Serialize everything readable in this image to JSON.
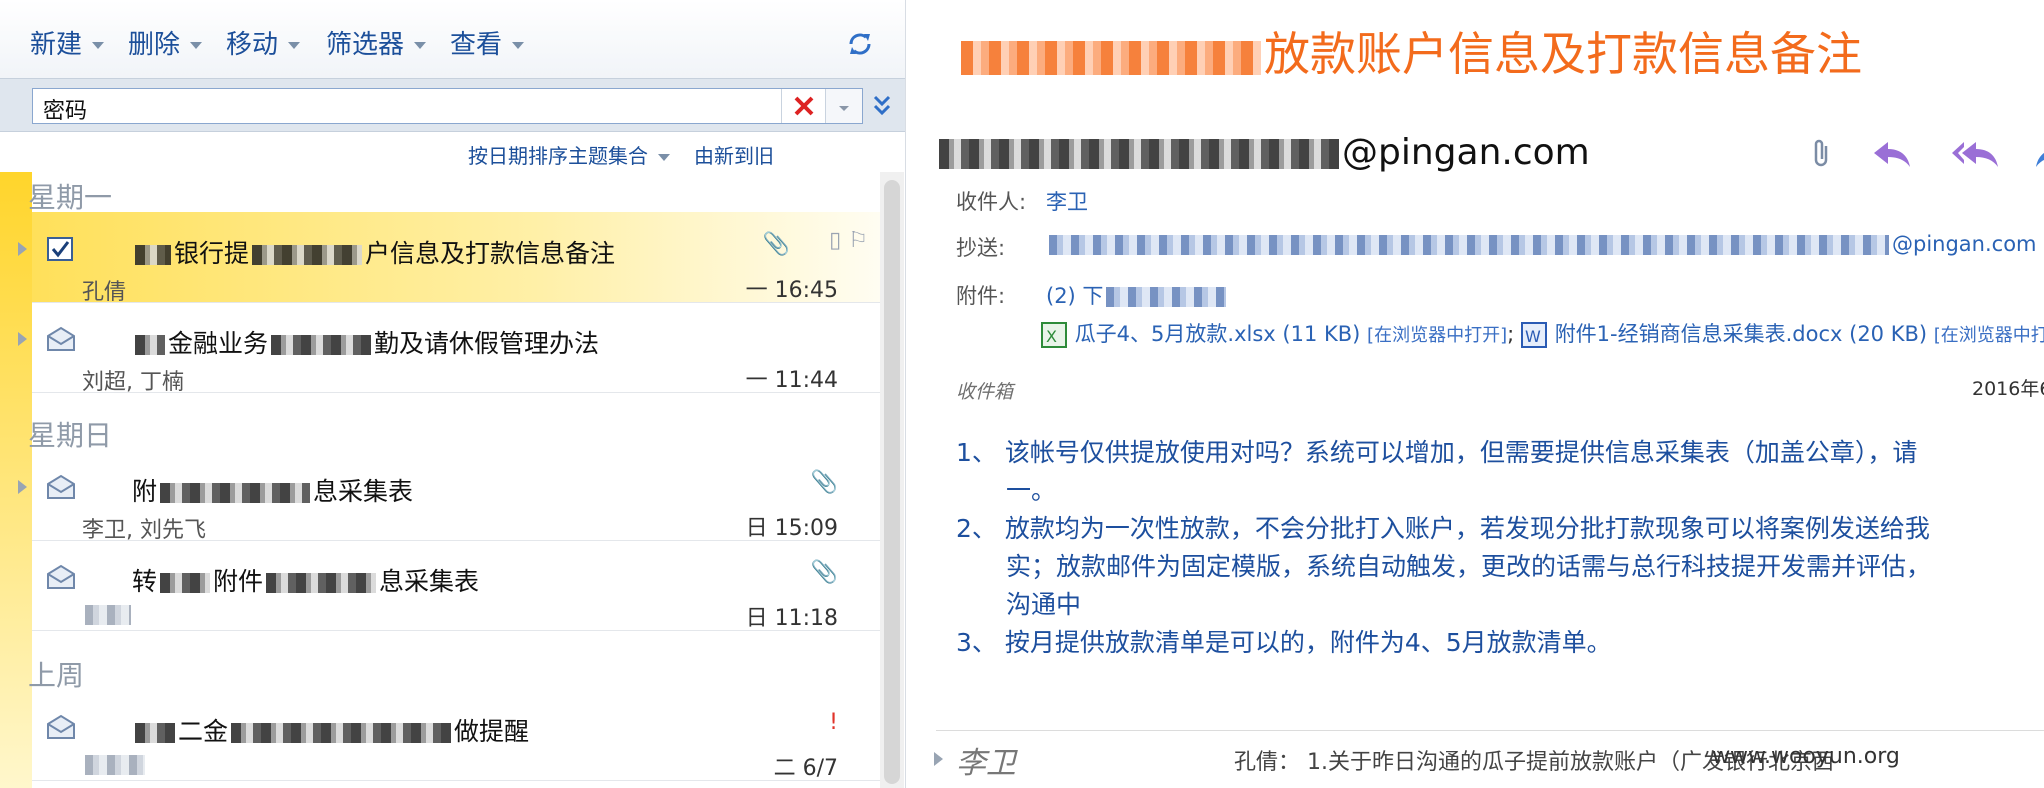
{
  "toolbar": {
    "menus": [
      {
        "label": "新建"
      },
      {
        "label": "删除"
      },
      {
        "label": "移动"
      },
      {
        "label": "筛选器"
      },
      {
        "label": "查看"
      }
    ]
  },
  "search": {
    "value": "密码"
  },
  "sort": {
    "arrange_label": "按日期排序主题集合",
    "order_label": "由新到旧"
  },
  "groups": [
    "星期一",
    "星期日",
    "上周"
  ],
  "messages": [
    {
      "subject_prefix": "",
      "subject_mid": "银行提",
      "subject_end": "户信息及打款信息备注",
      "from": "孔倩",
      "time": "一 16:45",
      "clip": true
    },
    {
      "subject_prefix": "",
      "subject_mid": "金融业务",
      "subject_end": "勤及请休假管理办法",
      "from": "刘超, 丁楠",
      "time": "一 11:44",
      "clip": false
    },
    {
      "subject_prefix": "附",
      "subject_mid": "",
      "subject_end": "息采集表",
      "from": "李卫, 刘先飞",
      "time": "日 15:09",
      "clip": true
    },
    {
      "subject_prefix": "转",
      "subject_mid": "附件",
      "subject_end": "息采集表",
      "from": "",
      "time": "日 11:18",
      "clip": true
    },
    {
      "subject_prefix": "",
      "subject_mid": "二金",
      "subject_end": "做提醒",
      "from": "",
      "time": "二 6/7",
      "clip": false
    }
  ],
  "reading": {
    "title_visible": "放款账户信息及打款信息备注",
    "sender_visible": "@pingan.com",
    "to_label": "收件人:",
    "to_value": "李卫",
    "cc_label": "抄送:",
    "cc_suffix": "@pingan.com",
    "attach_label": "附件:",
    "attach_count": "(2)  下",
    "attachments": [
      {
        "name": "瓜子4、5月放款.xlsx (11 KB)",
        "open": "[在浏览器中打开]"
      },
      {
        "name": "附件1-经销商信息采集表.docx (20 KB)",
        "open": "[在浏览器中打"
      }
    ],
    "folder": "收件箱",
    "date": "2016年6",
    "body_lines": [
      "1、  该帐号仅供提放使用对吗？系统可以增加，但需要提供信息采集表（加盖公章），请",
      "一。",
      "2、  放款均为一次性放款，不会分批打入账户，若发现分批打款现象可以将案例发送给我",
      "实；放款邮件为固定模版，系统自动触发，更改的话需与总行科技提开发需并评估，",
      "沟通中",
      "3、  按月提供放款清单是可以的，附件为4、5月放款清单。"
    ],
    "bottom_name": "李卫",
    "bottom_preview": "孔倩： 1.关于昨日沟通的瓜子提前放款账户（广发银行北京西",
    "watermark": "www.wooyun.org"
  }
}
